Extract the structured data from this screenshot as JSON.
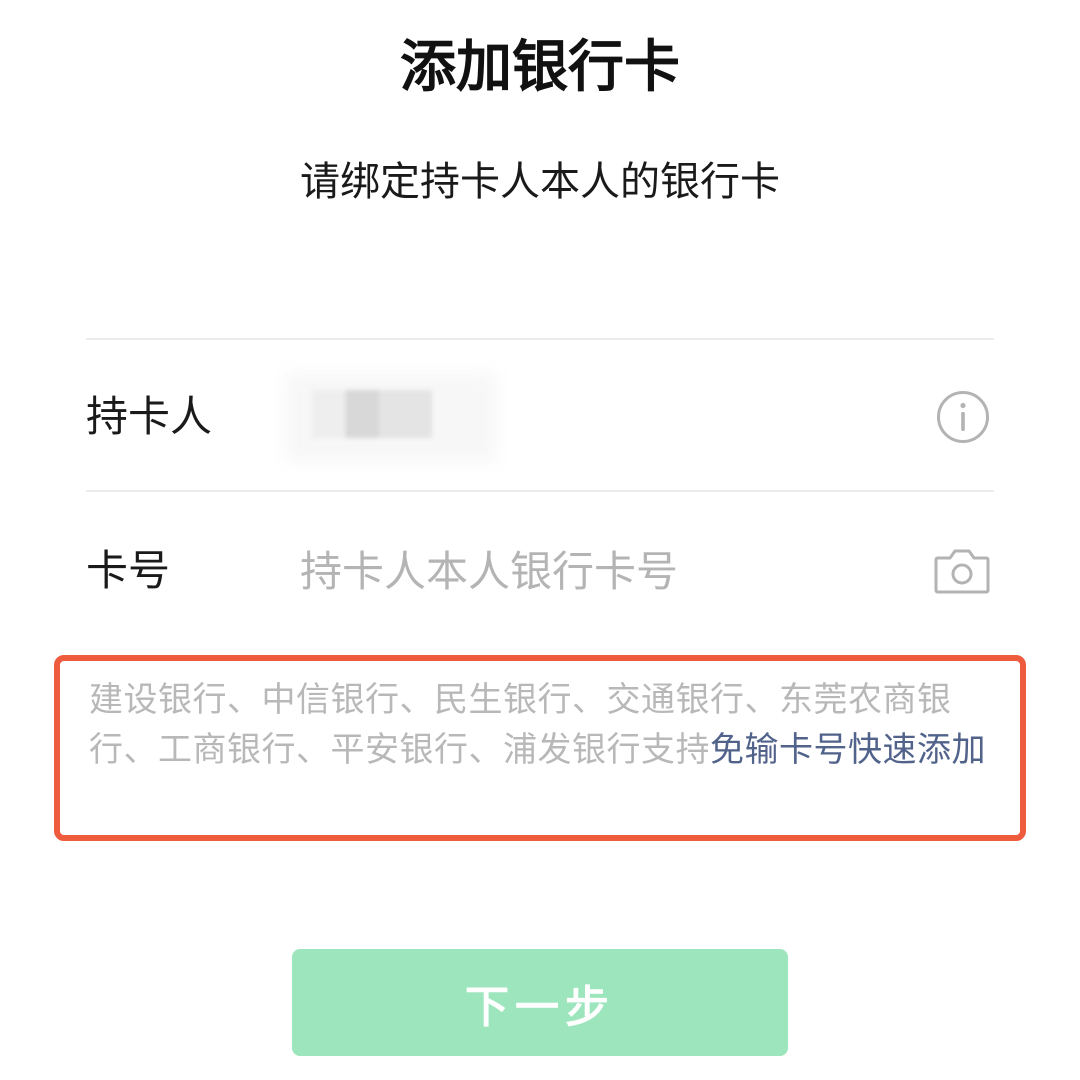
{
  "header": {
    "title": "添加银行卡",
    "subtitle": "请绑定持卡人本人的银行卡"
  },
  "form": {
    "cardholder": {
      "label": "持卡人",
      "value_state": "blurred",
      "icon": "info-icon"
    },
    "card_number": {
      "label": "卡号",
      "placeholder": "持卡人本人银行卡号",
      "value": "",
      "icon": "camera-icon"
    }
  },
  "notice": {
    "text": "建设银行、中信银行、民生银行、交通银行、东莞农商银行、工商银行、平安银行、浦发银行支持",
    "link_text": "免输卡号快速添加",
    "highlight_color": "#ef5b3d",
    "link_color": "#51638a"
  },
  "actions": {
    "next_label": "下一步",
    "next_color": "#9de5bd"
  }
}
